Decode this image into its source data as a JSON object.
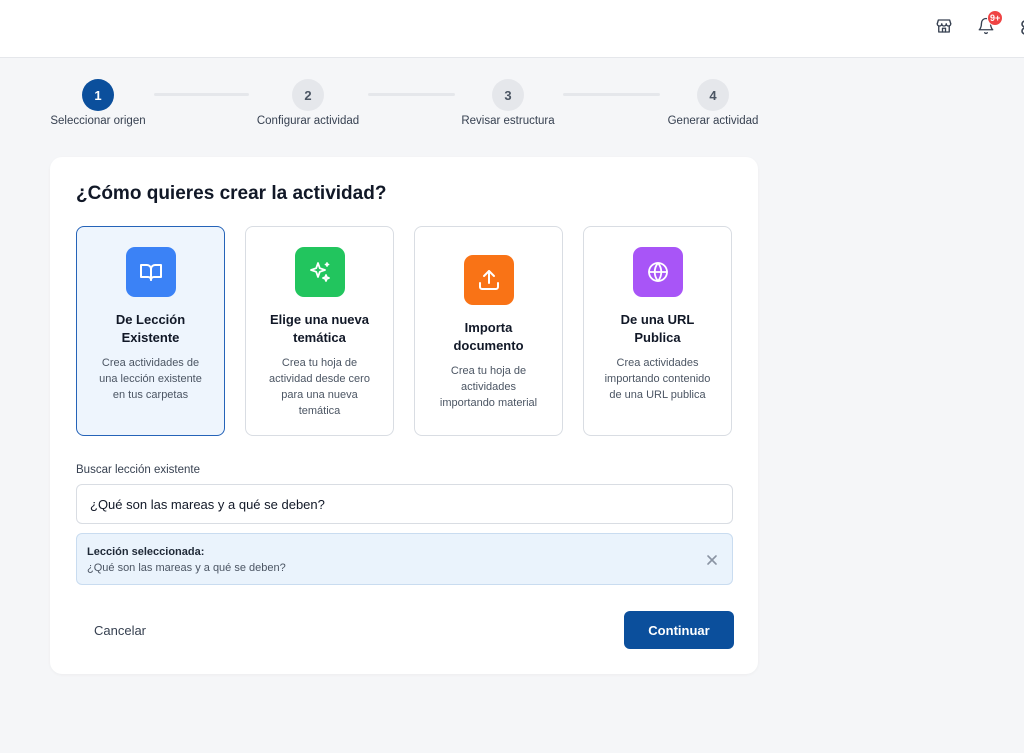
{
  "header": {
    "notification_badge": "9+",
    "icons": [
      "store-icon",
      "bell-icon"
    ]
  },
  "stepper": {
    "current_step": 1,
    "steps": [
      {
        "number": "1",
        "label": "Seleccionar origen"
      },
      {
        "number": "2",
        "label": "Configurar actividad"
      },
      {
        "number": "3",
        "label": "Revisar estructura"
      },
      {
        "number": "4",
        "label": "Generar actividad"
      }
    ]
  },
  "card": {
    "title": "¿Cómo quieres crear la actividad?",
    "options": [
      {
        "title": "De Lección Existente",
        "description": "Crea actividades de una lección existente en tus carpetas",
        "icon": "book-icon",
        "color": "#3b82f6",
        "selected": true
      },
      {
        "title": "Elige una nueva temática",
        "description": "Crea tu hoja de actividad desde cero para una nueva temática",
        "icon": "sparkles-icon",
        "color": "#22c55e",
        "selected": false
      },
      {
        "title": "Importa documento",
        "description": "Crea tu hoja de actividades importando material",
        "icon": "upload-icon",
        "color": "#f97316",
        "selected": false
      },
      {
        "title": "De una URL Publica",
        "description": "Crea actividades importando contenido de una URL publica",
        "icon": "globe-icon",
        "color": "#a855f7",
        "selected": false
      }
    ],
    "search": {
      "label": "Buscar lección existente",
      "value": "¿Qué son las mareas y a qué se deben?"
    },
    "selected_lesson": {
      "title": "Lección seleccionada:",
      "value": "¿Qué son las mareas y a qué se deben?"
    },
    "buttons": {
      "cancel": "Cancelar",
      "continue": "Continuar"
    }
  },
  "colors": {
    "primary": "#0b4f9c",
    "selected_bg": "#eef5fd",
    "badge": "#ef4444"
  }
}
